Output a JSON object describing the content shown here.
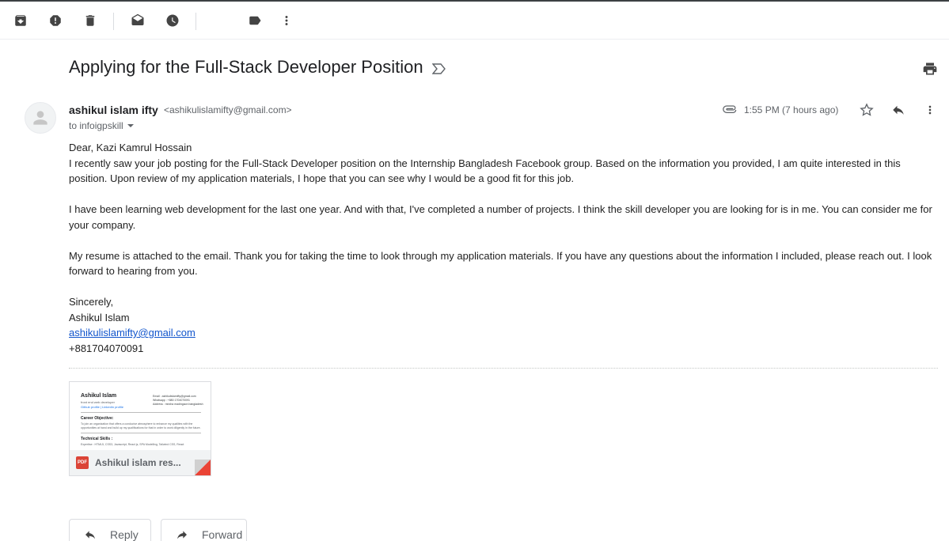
{
  "toolbar": {
    "icons": [
      "archive-icon",
      "report-spam-icon",
      "delete-icon",
      "mark-unread-icon",
      "snooze-icon",
      "label-icon",
      "more-vert-icon"
    ]
  },
  "email": {
    "subject": "Applying for the Full-Stack Developer Position",
    "sender_name": "ashikul islam ifty",
    "sender_email": "<ashikulislamifty@gmail.com>",
    "to_line": "to infoigpskill",
    "time": "1:55 PM (7 hours ago)",
    "body": {
      "greeting": "Dear, Kazi Kamrul Hossain",
      "para1": "I recently saw your job posting for the Full-Stack Developer position on the Internship Bangladesh Facebook group. Based on the information you provided, I am quite interested in this position. Upon review of my application materials, I hope that you can see why I would be a good fit for this job.",
      "para2": "I have been learning web development for the last one year. And with that, I've completed a number of projects. I think the skill developer you are looking for is in me. You can consider me for your company.",
      "para3": "My resume is attached to the email. Thank you for taking the time to look through my application materials. If you have any questions about the information I included, please reach out. I look forward to hearing from you.",
      "closing": "Sincerely,",
      "signature_name": "Ashikul Islam",
      "signature_email": "ashikulislamifty@gmail.com",
      "signature_phone": "+881704070091"
    }
  },
  "attachment": {
    "name": "Ashikul islam res...",
    "badge": "PDF",
    "preview": {
      "name": "Ashikul Islam",
      "role": "front end web developer",
      "links": "Github profile | Linkedin profile",
      "contact_lines": [
        "Email : ashikulislamifty@gmail.com",
        "Whatsapp : +880 1704070091",
        "Address : mirzha madingaon bangladesh"
      ],
      "section1": "Career Objective:",
      "section1_text": "To join an organization that offers a conducive atmosphere to enhance my qualities with the opportunities at hand and build up my qualifications for that in order to work diligently in the future.",
      "section2": "Technical Skills :",
      "section2_text": "Expertise : HTML5, CSS3, Javascript, React js, SPA Modelling, Tailwind CSS, React"
    }
  },
  "actions": {
    "reply": "Reply",
    "forward": "Forward"
  },
  "colors": {
    "link": "#1155cc",
    "pdf_red": "#db4437"
  }
}
